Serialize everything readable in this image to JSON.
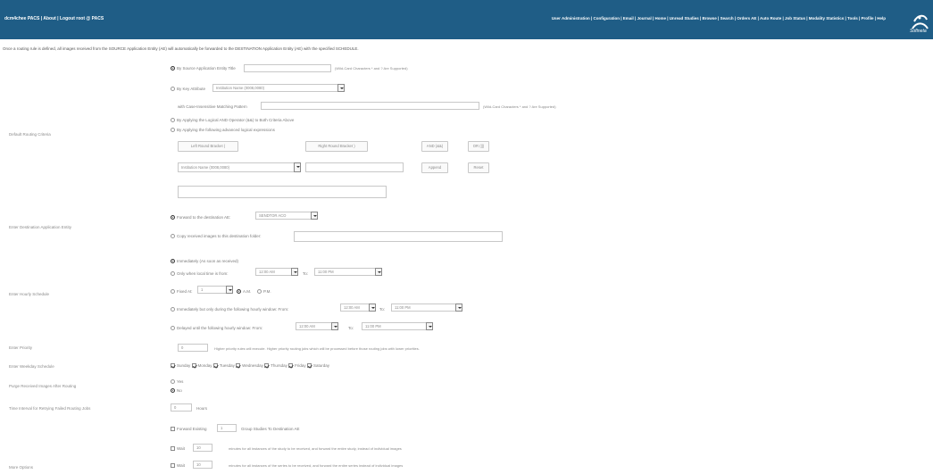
{
  "header": {
    "brand": "dcm4chee PACS | About | Logout root @ PACS",
    "nav": "User Administration | Configuration | Email | Journal | Home | Unread Studies | Browse | Search | Orders AE | Auto Route | Job Status | Modality Statistics | Tools | Profile | Help",
    "logo_icon": "logo-icon",
    "logo_text": "Softneta"
  },
  "instruction": "Once a routing rule is defined, all images received from the SOURCE Application Entity (AE) will automatically be forwarded to the DESTINATION Application Entity (AE) with the specified SCHEDULE.",
  "routing": {
    "label": "Default Routing Criteria",
    "by_source_label": "By Source Application Entity Title",
    "by_source_hint": "(Wild-Card Characters * and ? Are Supported)",
    "by_key_label": "By Key Attribute",
    "key_select": "Institution Name (0008,0080)",
    "pattern_label": "with Case-Insensitive Matching Pattern",
    "pattern_hint": "(Wild-Card Characters * and ? Are Supported)",
    "and_option": "By Applying the Logical AND Operator (&&) to Both Criteria Above",
    "expr_option": "By Applying the following advanced logical expressions",
    "left_bracket": "Left Round Bracket (",
    "right_bracket": "Right Round Bracket )",
    "and_btn": "AND (&&)",
    "or_btn": "OR (||)",
    "attr_select": "Institution Name (0008,0080)",
    "append_btn": "Append",
    "reset_btn": "Reset"
  },
  "destination": {
    "label": "Enter Destination Application Entity",
    "forward_label": "Forward to the destination AE:",
    "forward_select": "SENDTOR ACO",
    "copy_label": "Copy received images to this destination folder:"
  },
  "schedule": {
    "label": "Enter Hourly Schedule",
    "immediately": "Immediately (As soon as received)",
    "only_when": "Only when local time is from:",
    "from1": "12:00 AM",
    "to_label": "To:",
    "to1": "11:00 PM",
    "fixed_label": "Fixed At:",
    "fixed_value": "1",
    "am": "A.M.",
    "pm": "P.M.",
    "immediately_but": "Immediately but only during the following hourly window: From:",
    "from2": "12:00 AM",
    "to2": "11:00 PM",
    "delayed": "Delayed until the following hourly window: From:",
    "from3": "12:00 AM",
    "to3": "11:00 PM"
  },
  "priority": {
    "label": "Enter Priority",
    "value": "0",
    "hint": "Higher priority rules will execute. Higher priority routing jobs which will be processed before those routing jobs with lower priorities."
  },
  "weekly": {
    "label": "Enter Weekday Schedule",
    "days": [
      "Sunday",
      "Monday",
      "Tuesday",
      "Wednesday",
      "Thursday",
      "Friday",
      "Saturday"
    ]
  },
  "purge": {
    "label": "Purge Received Images After Routing",
    "yes": "Yes",
    "no": "No"
  },
  "retry": {
    "label": "Time Interval for Retrying Failed Routing Jobs",
    "value": "0",
    "unit": "Hours"
  },
  "more": {
    "label": "More Options",
    "forward_existing": "Forward Existing",
    "forward_existing_value": "1",
    "forward_existing_hint": "Group Studies To Destination AE",
    "wait1_label": "Wait",
    "wait1_value": "10",
    "wait1_hint": "minutes for all instances of the study to be received, and forward the entire study, instead of individual images",
    "wait2_label": "Wait",
    "wait2_value": "10",
    "wait2_hint": "minutes for all instances of the series to be received, and forward the entire series instead of individual images"
  }
}
